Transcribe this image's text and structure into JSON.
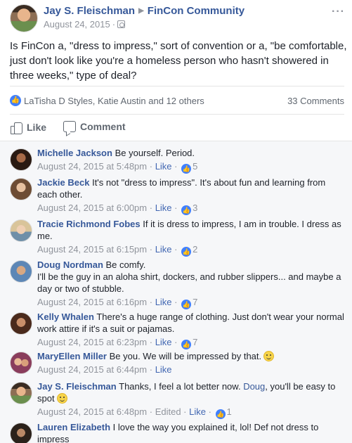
{
  "post": {
    "author": "Jay S. Fleischman",
    "group": "FinCon Community",
    "date": "August 24, 2015",
    "text": "Is FinCon a, \"dress to impress,\" sort of convention or a, \"be comfortable, just don't look like you're a homeless person who hasn't showered in three weeks,\" type of deal?",
    "reaction_names": "LaTisha D Styles, Katie Austin and 12 others",
    "comment_count": "33 Comments",
    "like_label": "Like",
    "comment_label": "Comment"
  },
  "icons": {
    "like": "thumbs-up-icon",
    "comment": "speech-bubble-icon",
    "privacy": "group-audience-icon",
    "more": "more-options-icon",
    "emoji": "smiley-emoji-icon"
  },
  "colors": {
    "link": "#365899",
    "accent": "#4080ff",
    "muted": "#90949c",
    "comment_bg": "#f6f7f9"
  },
  "comments": [
    {
      "author": "Michelle Jackson",
      "text": "Be yourself. Period.",
      "time": "August 24, 2015 at 5:48pm",
      "like": "Like",
      "likes": "5"
    },
    {
      "author": "Jackie Beck",
      "text": "It's not \"dress to impress\". It's about fun and learning from each other.",
      "time": "August 24, 2015 at 6:00pm",
      "like": "Like",
      "likes": "3"
    },
    {
      "author": "Tracie Richmond Fobes",
      "text": "If it is dress to impress, I am in trouble. I dress as me.",
      "time": "August 24, 2015 at 6:15pm",
      "like": "Like",
      "likes": "2"
    },
    {
      "author": "Doug Nordman",
      "text_line1": "Be comfy.",
      "text": "I'll be the guy in an aloha shirt, dockers, and rubber slippers... and maybe a day or two of stubble.",
      "time": "August 24, 2015 at 6:16pm",
      "like": "Like",
      "likes": "7"
    },
    {
      "author": "Kelly Whalen",
      "text": "There's a huge range of clothing. Just don't wear your normal work attire if it's a suit or pajamas.",
      "time": "August 24, 2015 at 6:23pm",
      "like": "Like",
      "likes": "7"
    },
    {
      "author": "MaryEllen Miller",
      "text": "Be you. We will be impressed by that.",
      "time": "August 24, 2015 at 6:44pm",
      "like": "Like"
    },
    {
      "author": "Jay S. Fleischman",
      "text": "Thanks, I feel a lot better now.",
      "mention": "Doug",
      "text_after": ", you'll be easy to spot",
      "time": "August 24, 2015 at 6:48pm",
      "edited": "Edited",
      "like": "Like",
      "likes": "1"
    },
    {
      "author": "Lauren Elizabeth",
      "text": "I love the way you explained it, lol! Def not dress to impress"
    }
  ]
}
